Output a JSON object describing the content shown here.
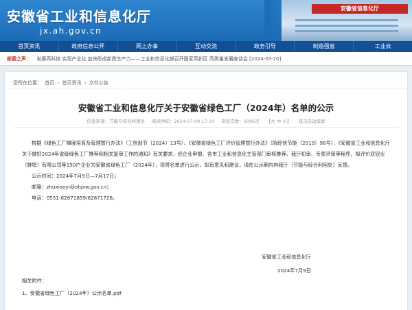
{
  "header": {
    "title": "安徽省工业和信息化厅",
    "domain": "jx.ah.gov.cn",
    "building_sign": "安徽省信息化厅"
  },
  "nav": [
    "首页资讯",
    "政府信息公开",
    "网上办事",
    "互动交流",
    "政务引导",
    "制造强省",
    "工业云"
  ],
  "notice": {
    "label": "部委之声：",
    "text": "发展高科技 实现产业化 加快形成新质生产力——工业和信息化部召开国家高新区 高质量发展座谈会 [2024-03-20]"
  },
  "breadcrumb": [
    "您所在位置：",
    "首页",
    "›",
    "首页资讯",
    "›",
    "文件公告"
  ],
  "article": {
    "title": "安徽省工业和信息化厅关于安徽省绿色工厂（2024年）名单的公示",
    "meta": {
      "source": "信息来源：节能与综合利用处",
      "time": "阅读时间：2024-07-09 17:10",
      "views": "浏览次数：6086次",
      "font": "【大 中 小】",
      "print": "双击自动滚屏"
    },
    "paragraph": "根据《绿色工厂梯度培育及管理暂行办法》（工信部节〔2024〕13号）、《安徽省绿色工厂评价管理暂行办法》（皖经信节能〔2019〕98号）、《安徽省工业和信息化厅关于做好2024年省级绿色工厂推荐和相关复审工作的通知》有关要求，经企业申报、各市工业和信息化主管部门审核推荐、我厅初审、专家评审等程序，拟评价双钗业（蚌埠）有限公司等150户企业为安徽省绿色工厂（2024年），现将名单进行公示，如有意见和建议，请在公示期内向我厅（节能与综合利用处）反馈。",
    "period": "公示时间：2024年7月9日—7月17日；",
    "email": "邮箱：zhuxiaoyi@ahjxw.gov.cn；",
    "phone": "电话：0551-62871859/62871728。",
    "signature_org": "安徽省工业和信息化厅",
    "signature_date": "2024年7月9日",
    "attachments_label": "相关附件：",
    "attachment_1": "1、安徽省绿色工厂（2024年）公示名单.pdf"
  }
}
